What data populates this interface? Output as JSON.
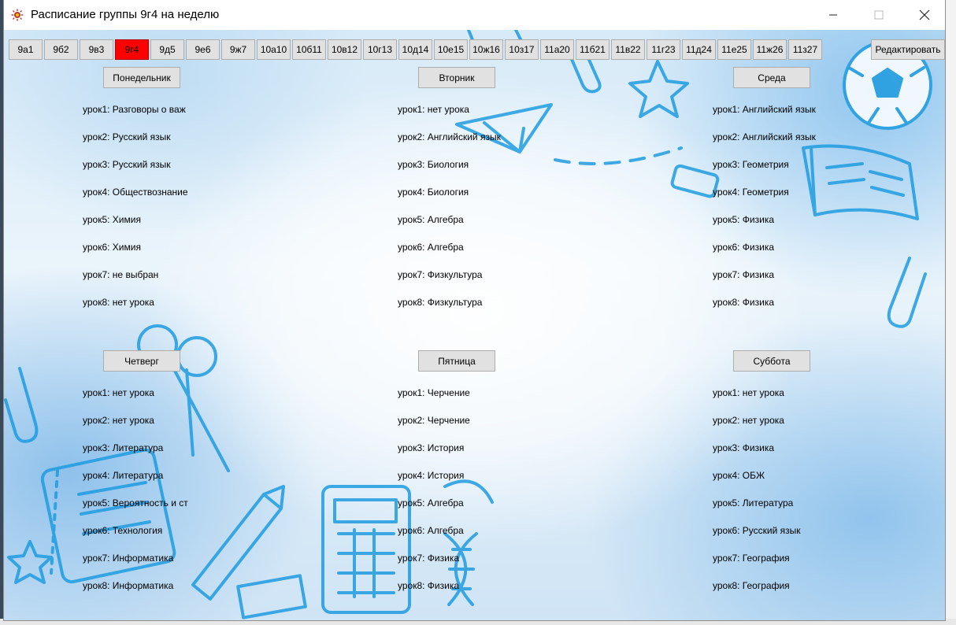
{
  "window": {
    "title": "Расписание группы 9г4 на неделю"
  },
  "groups": [
    {
      "label": "9а1"
    },
    {
      "label": "9б2"
    },
    {
      "label": "9в3"
    },
    {
      "label": "9г4",
      "active": true
    },
    {
      "label": "9д5"
    },
    {
      "label": "9е6"
    },
    {
      "label": "9ж7"
    },
    {
      "label": "10а10"
    },
    {
      "label": "10б11"
    },
    {
      "label": "10в12"
    },
    {
      "label": "10г13"
    },
    {
      "label": "10д14"
    },
    {
      "label": "10е15"
    },
    {
      "label": "10ж16"
    },
    {
      "label": "10з17"
    },
    {
      "label": "11а20"
    },
    {
      "label": "11б21"
    },
    {
      "label": "11в22"
    },
    {
      "label": "11г23"
    },
    {
      "label": "11д24"
    },
    {
      "label": "11е25"
    },
    {
      "label": "11ж26"
    },
    {
      "label": "11з27"
    }
  ],
  "edit_label": "Редактировать",
  "days": [
    {
      "name": "Понедельник",
      "lessons": [
        "урок1: Разговоры о важ",
        "урок2: Русский язык",
        "урок3: Русский язык",
        "урок4: Обществознание",
        "урок5: Химия",
        "урок6: Химия",
        "урок7: не выбран",
        "урок8: нет урока"
      ]
    },
    {
      "name": "Вторник",
      "lessons": [
        "урок1: нет урока",
        "урок2: Английский язык",
        "урок3: Биология",
        "урок4: Биология",
        "урок5: Алгебра",
        "урок6: Алгебра",
        "урок7: Физкультура",
        "урок8: Физкультура"
      ]
    },
    {
      "name": "Среда",
      "lessons": [
        "урок1: Английский язык",
        "урок2: Английский язык",
        "урок3: Геометрия",
        "урок4: Геометрия",
        "урок5: Физика",
        "урок6: Физика",
        "урок7: Физика",
        "урок8: Физика"
      ]
    },
    {
      "name": "Четверг",
      "lessons": [
        "урок1: нет урока",
        "урок2: нет урока",
        "урок3: Литература",
        "урок4: Литература",
        "урок5: Вероятность и ст",
        "урок6: Технология",
        "урок7: Информатика",
        "урок8: Информатика"
      ]
    },
    {
      "name": "Пятница",
      "lessons": [
        "урок1: Черчение",
        "урок2: Черчение",
        "урок3: История",
        "урок4: История",
        "урок5: Алгебра",
        "урок6: Алгебра",
        "урок7: Физика",
        "урок8: Физика"
      ]
    },
    {
      "name": "Суббота",
      "lessons": [
        "урок1: нет урока",
        "урок2: нет урока",
        "урок3: Физика",
        "урок4: ОБЖ",
        "урок5: Литература",
        "урок6: Русский язык",
        "урок7: География",
        "урок8: География"
      ]
    }
  ],
  "colors": {
    "active_tab": "#ff0000",
    "button_face": "#e1e1e1",
    "doodle_blue": "#1e9be0"
  },
  "icons": {
    "app": "sun-icon",
    "minimize": "minimize-icon",
    "maximize": "maximize-icon",
    "close": "close-icon"
  }
}
